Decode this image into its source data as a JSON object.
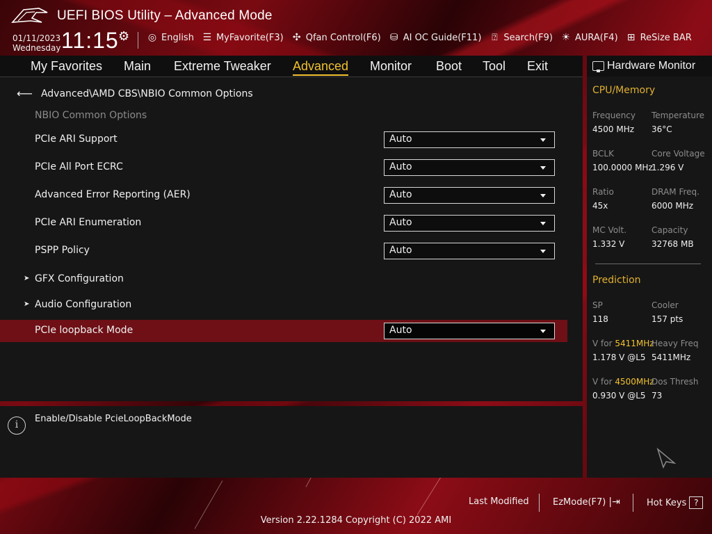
{
  "window": {
    "title": "UEFI BIOS Utility – Advanced Mode"
  },
  "status": {
    "date": "01/11/2023",
    "weekday": "Wednesday",
    "time": "11:15"
  },
  "toolbar": [
    {
      "icon": "globe-icon",
      "label": "English"
    },
    {
      "icon": "favorite-icon",
      "label": "MyFavorite(F3)"
    },
    {
      "icon": "fan-icon",
      "label": "Qfan Control(F6)"
    },
    {
      "icon": "ai-chip-icon",
      "label": "AI OC Guide(F11)"
    },
    {
      "icon": "search-icon",
      "label": "Search(F9)"
    },
    {
      "icon": "aura-icon",
      "label": "AURA(F4)"
    },
    {
      "icon": "resize-bar-icon",
      "label": "ReSize BAR"
    }
  ],
  "nav": {
    "tabs": [
      "My Favorites",
      "Main",
      "Extreme Tweaker",
      "Advanced",
      "Monitor",
      "Boot",
      "Tool",
      "Exit"
    ],
    "active": "Advanced"
  },
  "main": {
    "breadcrumb": "Advanced\\AMD CBS\\NBIO Common Options",
    "section_title": "NBIO Common Options",
    "settings": [
      {
        "label": "PCIe ARI Support",
        "value": "Auto"
      },
      {
        "label": "PCIe All Port ECRC",
        "value": "Auto"
      },
      {
        "label": "Advanced Error Reporting (AER)",
        "value": "Auto"
      },
      {
        "label": "PCIe ARI Enumeration",
        "value": "Auto"
      },
      {
        "label": "PSPP Policy",
        "value": "Auto"
      }
    ],
    "submenus": [
      {
        "label": "GFX Configuration"
      },
      {
        "label": "Audio Configuration"
      }
    ],
    "selected_setting": {
      "label": "PCIe loopback Mode",
      "value": "Auto"
    }
  },
  "help": {
    "text": "Enable/Disable PcieLoopBackMode"
  },
  "hardware_monitor": {
    "title": "Hardware Monitor",
    "cpu_memory": {
      "title": "CPU/Memory",
      "items": [
        {
          "label": "Frequency",
          "value": "4500 MHz"
        },
        {
          "label": "Temperature",
          "value": "36°C"
        },
        {
          "label": "BCLK",
          "value": "100.0000 MHz"
        },
        {
          "label": "Core Voltage",
          "value": "1.296 V"
        },
        {
          "label": "Ratio",
          "value": "45x"
        },
        {
          "label": "DRAM Freq.",
          "value": "6000 MHz"
        },
        {
          "label": "MC Volt.",
          "value": "1.332 V"
        },
        {
          "label": "Capacity",
          "value": "32768 MB"
        }
      ]
    },
    "prediction": {
      "title": "Prediction",
      "sp_label": "SP",
      "sp_value": "118",
      "cooler_label": "Cooler",
      "cooler_value": "157 pts",
      "v1_prefix": "V for ",
      "v1_freq": "5411MHz",
      "v1_value": "1.178 V @L5",
      "heavy_label": "Heavy Freq",
      "heavy_value": "5411MHz",
      "v2_prefix": "V for ",
      "v2_freq": "4500MHz",
      "v2_value": "0.930 V @L5",
      "dos_label": "Dos Thresh",
      "dos_value": "73"
    }
  },
  "footer": {
    "last_modified": "Last Modified",
    "ezmode": "EzMode(F7)",
    "hotkeys": "Hot Keys",
    "hotkeys_key": "?",
    "version": "Version 2.22.1284 Copyright (C) 2022 AMI"
  },
  "colors": {
    "accent": "#f2c12e",
    "highlight_row": "#6e1016",
    "panel": "#161616"
  }
}
